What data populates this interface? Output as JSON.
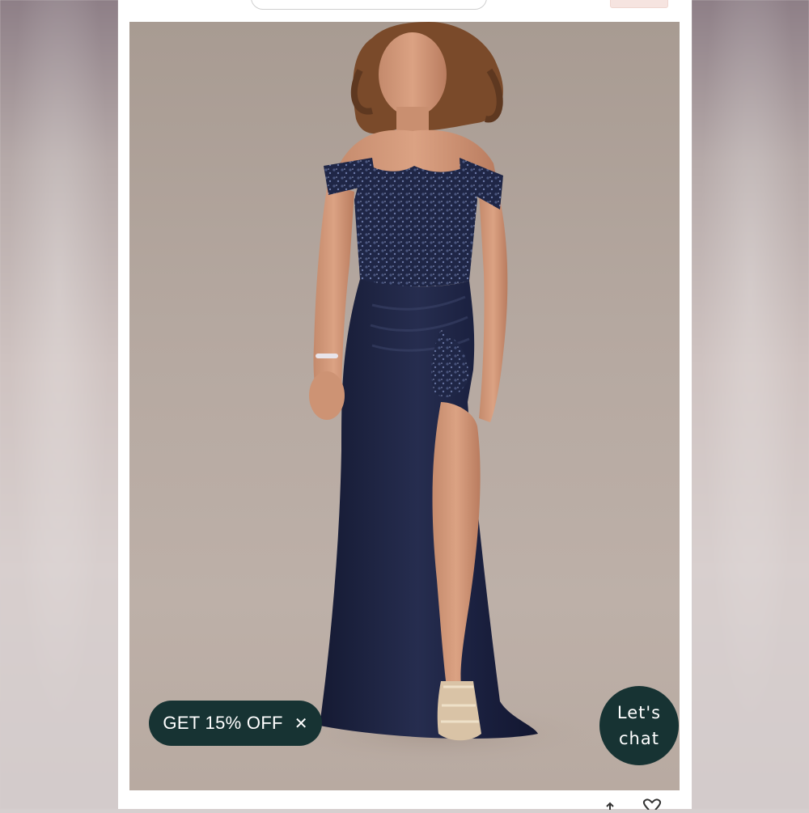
{
  "page": {
    "background_color": "#d6cfcf",
    "accent_color": "#173333"
  },
  "product_image": {
    "icon": "product-photo",
    "subject_colors": {
      "backdrop": "#b3a69d",
      "gown": "#1d2340"
    }
  },
  "promo_button": {
    "label": "GET 15% OFF",
    "close_icon": "close-icon"
  },
  "chat_button": {
    "label": "Let's chat"
  },
  "bottom_bar": {
    "heart_icon": "heart-icon"
  }
}
